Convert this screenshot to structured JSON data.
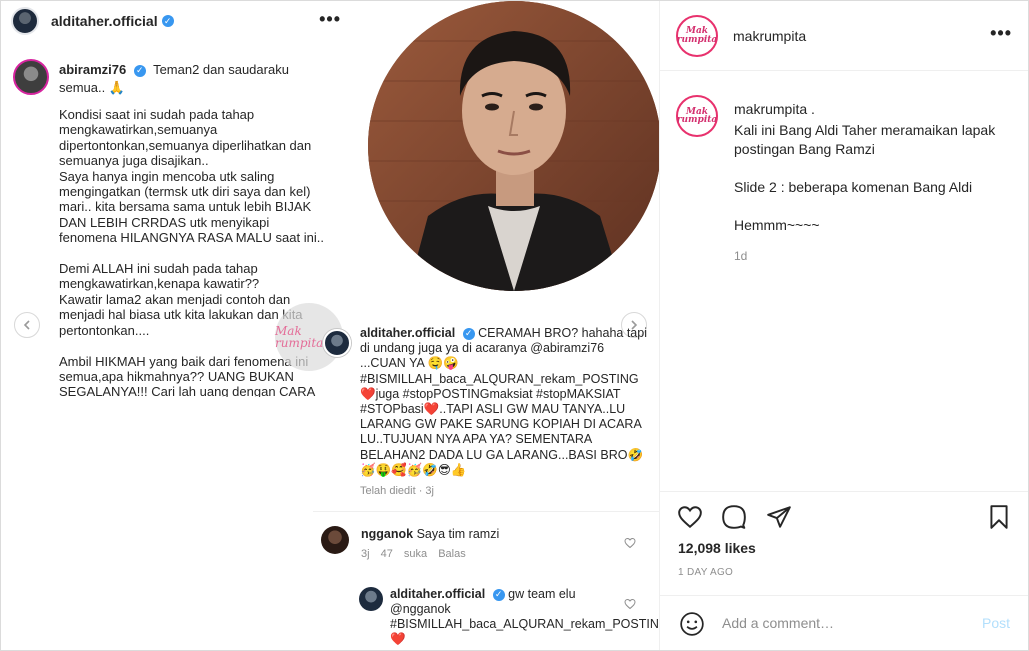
{
  "media": {
    "post_user": "alditaher.official",
    "more_label": "•••",
    "left_comment": {
      "user": "abiramzi76",
      "intro": "Teman2 dan saudaraku semua.. 🙏",
      "body": "Kondisi saat ini sudah pada tahap mengkawatirkan,semuanya dipertontonkan,semuanya diperlihatkan dan semuanya juga disajikan..\nSaya hanya ingin mencoba utk saling mengingatkan (termsk utk diri saya dan kel) mari.. kita bersama sama untuk lebih BIJAK DAN LEBIH CRRDAS utk menyikapi fenomena HILANGNYA RASA MALU saat ini..\n\nDemi ALLAH ini sudah pada tahap mengkawatirkan,kenapa kawatir??\nKawatir lama2 akan menjadi contoh dan menjadi hal biasa utk kita lakukan dan kita pertontonkan....\n\nAmbil HIKMAH yang baik dari fenomena ini semua,apa hikmahnya?? UANG BUKAN SEGALANYA!!! Cari lah uang dengan CARA"
    },
    "watermark": "Mak rumpita",
    "aldi_comment": {
      "user": "alditaher.official",
      "text": "CERAMAH BRO? hahaha tapi di undang juga ya di acaranya @abiramzi76 ...CUAN YA 🤤🤪 #BISMILLAH_baca_ALQURAN_rekam_POSTING❤️juga #stopPOSTINGmaksiat #stopMAKSIAT #STOPbasi❤️..TAPI ASLI GW MAU TANYA..LU LARANG GW PAKE SARUNG KOPIAH DI ACARA LU..TUJUAN NYA APA YA? SEMENTARA BELAHAN2 DADA LU GA LARANG...BASI BRO🤣🥳🤑🥰🥳🤣😎👍",
      "meta": "Telah diedit · 3j"
    },
    "reply1": {
      "user": "ngganok",
      "text": "Saya tim ramzi",
      "time": "3j",
      "likes": "47 suka",
      "reply": "Balas"
    },
    "reply2": {
      "user": "alditaher.official",
      "text": "gw team elu @ngganok #BISMILLAH_baca_ALQURAN_rekam_POSTING❤️"
    }
  },
  "side": {
    "username": "makrumpita",
    "brand_logo_text": "Mak rumpita",
    "more_label": "•••",
    "caption_user": "makrumpita .",
    "caption_body": "Kali ini Bang Aldi Taher meramaikan lapak postingan Bang Ramzi\n\nSlide 2 : beberapa komenan Bang Aldi\n\nHemmm~~~~",
    "caption_time": "1d",
    "likes": "12,098 likes",
    "ago": "1 DAY AGO",
    "comment_placeholder": "Add a comment…",
    "post_label": "Post"
  },
  "colors": {
    "brand_pink": "#e8316d",
    "verified_blue": "#3897f0",
    "post_disabled": "#b2dffc",
    "heart_red": "#ed4956"
  }
}
